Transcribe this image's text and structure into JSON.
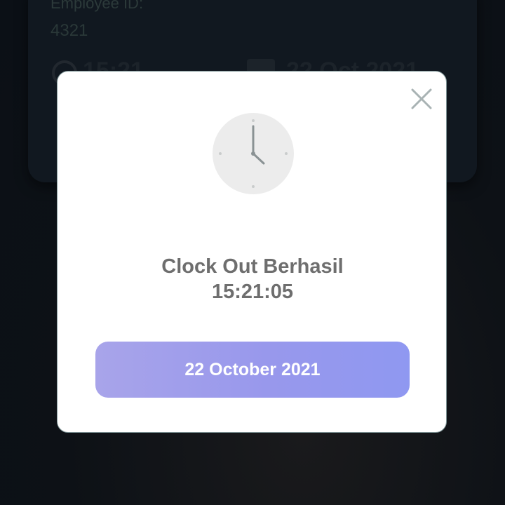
{
  "background": {
    "employee_label": "Employee ID:",
    "employee_id": "4321",
    "time_value": "15:21",
    "date_value": "22 Oct 2021"
  },
  "modal": {
    "title": "Clock Out Berhasil",
    "time": "15:21:05",
    "date_button_label": "22 October 2021",
    "icons": {
      "close": "close-icon",
      "clock": "clock-icon"
    },
    "colors": {
      "title_text": "#6e6e6e",
      "button_gradient_start": "#a8a4ea",
      "button_gradient_end": "#8f98f1",
      "button_text": "#ffffff"
    }
  }
}
